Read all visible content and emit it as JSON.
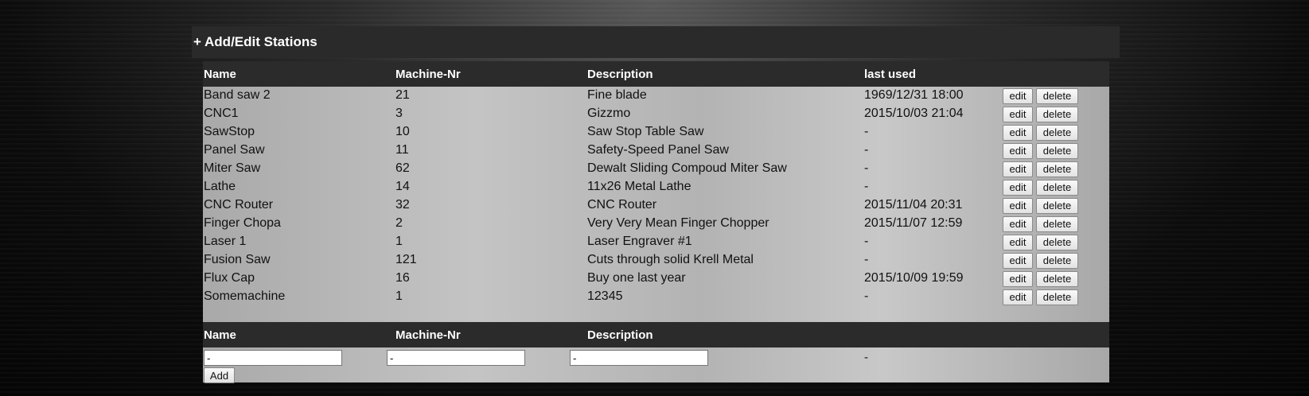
{
  "panel": {
    "title": "+ Add/Edit Stations"
  },
  "table": {
    "headers": {
      "name": "Name",
      "machine_nr": "Machine-Nr",
      "description": "Description",
      "last_used": "last used"
    },
    "edit_label": "edit",
    "delete_label": "delete",
    "rows": [
      {
        "name": "Band saw 2",
        "machine_nr": "21",
        "description": "Fine blade",
        "last_used": "1969/12/31 18:00"
      },
      {
        "name": "CNC1",
        "machine_nr": "3",
        "description": "Gizzmo",
        "last_used": "2015/10/03 21:04"
      },
      {
        "name": "SawStop",
        "machine_nr": "10",
        "description": "Saw Stop Table Saw",
        "last_used": "-"
      },
      {
        "name": "Panel Saw",
        "machine_nr": "11",
        "description": "Safety-Speed Panel Saw",
        "last_used": "-"
      },
      {
        "name": "Miter Saw",
        "machine_nr": "62",
        "description": "Dewalt Sliding Compoud Miter Saw",
        "last_used": "-"
      },
      {
        "name": "Lathe",
        "machine_nr": "14",
        "description": "11x26 Metal Lathe",
        "last_used": "-"
      },
      {
        "name": "CNC Router",
        "machine_nr": "32",
        "description": "CNC Router",
        "last_used": "2015/11/04 20:31"
      },
      {
        "name": "Finger Chopa",
        "machine_nr": "2",
        "description": "Very Very Mean Finger Chopper",
        "last_used": "2015/11/07 12:59"
      },
      {
        "name": "Laser 1",
        "machine_nr": "1",
        "description": "Laser Engraver #1",
        "last_used": "-"
      },
      {
        "name": "Fusion Saw",
        "machine_nr": "121",
        "description": "Cuts through solid Krell Metal",
        "last_used": "-"
      },
      {
        "name": "Flux Cap",
        "machine_nr": "16",
        "description": "Buy one last year",
        "last_used": "2015/10/09 19:59"
      },
      {
        "name": "Somemachine",
        "machine_nr": "1",
        "description": "12345",
        "last_used": "-"
      }
    ]
  },
  "add_form": {
    "headers": {
      "name": "Name",
      "machine_nr": "Machine-Nr",
      "description": "Description"
    },
    "name_value": "-",
    "machine_nr_value": "-",
    "description_value": "-",
    "last_used_value": "-",
    "add_label": "Add"
  }
}
